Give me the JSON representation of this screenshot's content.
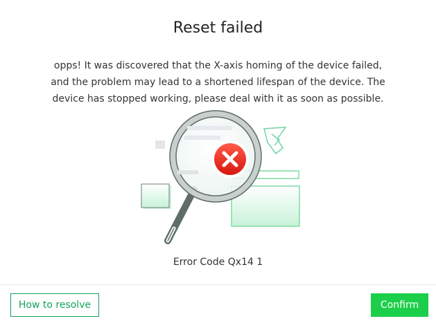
{
  "dialog": {
    "title": "Reset failed",
    "message": "opps! It was discovered that the X-axis homing of the device failed, and the problem may lead to a shortened lifespan of the device. The device has stopped working, please deal with it as soon as possible.",
    "error_code": "Error Code Qx14 1",
    "illustration_icon": "magnifier-error-icon"
  },
  "footer": {
    "resolve_label": "How to resolve",
    "confirm_label": "Confirm"
  },
  "colors": {
    "accent_green": "#1ccf4a",
    "outline_green": "#12a55a",
    "error_red": "#e8241b"
  }
}
